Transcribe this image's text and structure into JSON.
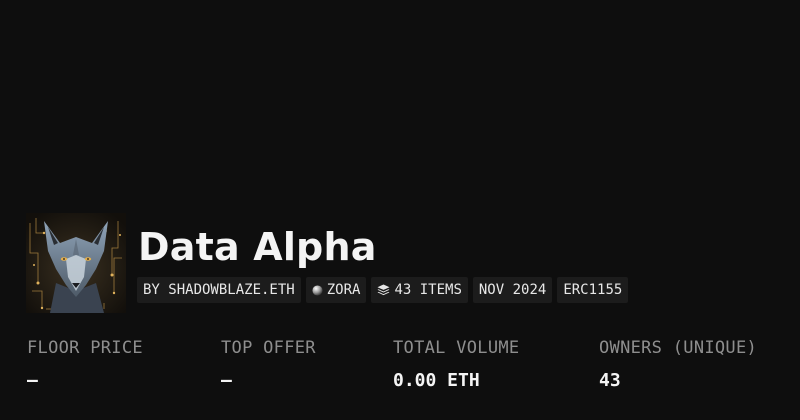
{
  "collection": {
    "title": "Data Alpha",
    "avatar_icon": "wolf-artwork"
  },
  "tags": {
    "creator": "BY SHADOWBLAZE.ETH",
    "network": "ZORA",
    "network_icon": "zora-orb-icon",
    "items": "43 ITEMS",
    "items_icon": "stack-icon",
    "date": "NOV 2024",
    "standard": "ERC1155"
  },
  "stats": {
    "floor_price": {
      "label": "FLOOR PRICE",
      "value": "—"
    },
    "top_offer": {
      "label": "TOP OFFER",
      "value": "—"
    },
    "total_volume": {
      "label": "TOTAL VOLUME",
      "value": "0.00 ETH"
    },
    "owners": {
      "label": "OWNERS (UNIQUE)",
      "value": "43"
    }
  },
  "colors": {
    "background": "#0e0e0e",
    "tag_background": "#1c1c1c",
    "label": "#8e8e8e",
    "text": "#f4f4f4"
  }
}
